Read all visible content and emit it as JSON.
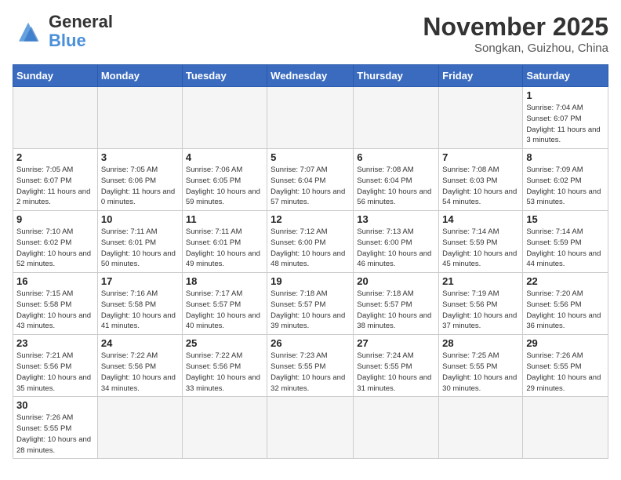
{
  "header": {
    "logo_general": "General",
    "logo_blue": "Blue",
    "month_title": "November 2025",
    "location": "Songkan, Guizhou, China"
  },
  "days_of_week": [
    "Sunday",
    "Monday",
    "Tuesday",
    "Wednesday",
    "Thursday",
    "Friday",
    "Saturday"
  ],
  "weeks": [
    [
      {
        "day": "",
        "empty": true
      },
      {
        "day": "",
        "empty": true
      },
      {
        "day": "",
        "empty": true
      },
      {
        "day": "",
        "empty": true
      },
      {
        "day": "",
        "empty": true
      },
      {
        "day": "",
        "empty": true
      },
      {
        "day": "1",
        "sunrise": "7:04 AM",
        "sunset": "6:07 PM",
        "daylight": "11 hours and 3 minutes."
      }
    ],
    [
      {
        "day": "2",
        "sunrise": "7:05 AM",
        "sunset": "6:07 PM",
        "daylight": "11 hours and 2 minutes."
      },
      {
        "day": "3",
        "sunrise": "7:05 AM",
        "sunset": "6:06 PM",
        "daylight": "11 hours and 0 minutes."
      },
      {
        "day": "4",
        "sunrise": "7:06 AM",
        "sunset": "6:05 PM",
        "daylight": "10 hours and 59 minutes."
      },
      {
        "day": "5",
        "sunrise": "7:07 AM",
        "sunset": "6:04 PM",
        "daylight": "10 hours and 57 minutes."
      },
      {
        "day": "6",
        "sunrise": "7:08 AM",
        "sunset": "6:04 PM",
        "daylight": "10 hours and 56 minutes."
      },
      {
        "day": "7",
        "sunrise": "7:08 AM",
        "sunset": "6:03 PM",
        "daylight": "10 hours and 54 minutes."
      },
      {
        "day": "8",
        "sunrise": "7:09 AM",
        "sunset": "6:02 PM",
        "daylight": "10 hours and 53 minutes."
      }
    ],
    [
      {
        "day": "9",
        "sunrise": "7:10 AM",
        "sunset": "6:02 PM",
        "daylight": "10 hours and 52 minutes."
      },
      {
        "day": "10",
        "sunrise": "7:11 AM",
        "sunset": "6:01 PM",
        "daylight": "10 hours and 50 minutes."
      },
      {
        "day": "11",
        "sunrise": "7:11 AM",
        "sunset": "6:01 PM",
        "daylight": "10 hours and 49 minutes."
      },
      {
        "day": "12",
        "sunrise": "7:12 AM",
        "sunset": "6:00 PM",
        "daylight": "10 hours and 48 minutes."
      },
      {
        "day": "13",
        "sunrise": "7:13 AM",
        "sunset": "6:00 PM",
        "daylight": "10 hours and 46 minutes."
      },
      {
        "day": "14",
        "sunrise": "7:14 AM",
        "sunset": "5:59 PM",
        "daylight": "10 hours and 45 minutes."
      },
      {
        "day": "15",
        "sunrise": "7:14 AM",
        "sunset": "5:59 PM",
        "daylight": "10 hours and 44 minutes."
      }
    ],
    [
      {
        "day": "16",
        "sunrise": "7:15 AM",
        "sunset": "5:58 PM",
        "daylight": "10 hours and 43 minutes."
      },
      {
        "day": "17",
        "sunrise": "7:16 AM",
        "sunset": "5:58 PM",
        "daylight": "10 hours and 41 minutes."
      },
      {
        "day": "18",
        "sunrise": "7:17 AM",
        "sunset": "5:57 PM",
        "daylight": "10 hours and 40 minutes."
      },
      {
        "day": "19",
        "sunrise": "7:18 AM",
        "sunset": "5:57 PM",
        "daylight": "10 hours and 39 minutes."
      },
      {
        "day": "20",
        "sunrise": "7:18 AM",
        "sunset": "5:57 PM",
        "daylight": "10 hours and 38 minutes."
      },
      {
        "day": "21",
        "sunrise": "7:19 AM",
        "sunset": "5:56 PM",
        "daylight": "10 hours and 37 minutes."
      },
      {
        "day": "22",
        "sunrise": "7:20 AM",
        "sunset": "5:56 PM",
        "daylight": "10 hours and 36 minutes."
      }
    ],
    [
      {
        "day": "23",
        "sunrise": "7:21 AM",
        "sunset": "5:56 PM",
        "daylight": "10 hours and 35 minutes."
      },
      {
        "day": "24",
        "sunrise": "7:22 AM",
        "sunset": "5:56 PM",
        "daylight": "10 hours and 34 minutes."
      },
      {
        "day": "25",
        "sunrise": "7:22 AM",
        "sunset": "5:56 PM",
        "daylight": "10 hours and 33 minutes."
      },
      {
        "day": "26",
        "sunrise": "7:23 AM",
        "sunset": "5:55 PM",
        "daylight": "10 hours and 32 minutes."
      },
      {
        "day": "27",
        "sunrise": "7:24 AM",
        "sunset": "5:55 PM",
        "daylight": "10 hours and 31 minutes."
      },
      {
        "day": "28",
        "sunrise": "7:25 AM",
        "sunset": "5:55 PM",
        "daylight": "10 hours and 30 minutes."
      },
      {
        "day": "29",
        "sunrise": "7:26 AM",
        "sunset": "5:55 PM",
        "daylight": "10 hours and 29 minutes."
      }
    ],
    [
      {
        "day": "30",
        "sunrise": "7:26 AM",
        "sunset": "5:55 PM",
        "daylight": "10 hours and 28 minutes."
      },
      {
        "day": "",
        "empty": true
      },
      {
        "day": "",
        "empty": true
      },
      {
        "day": "",
        "empty": true
      },
      {
        "day": "",
        "empty": true
      },
      {
        "day": "",
        "empty": true
      },
      {
        "day": "",
        "empty": true
      }
    ]
  ]
}
